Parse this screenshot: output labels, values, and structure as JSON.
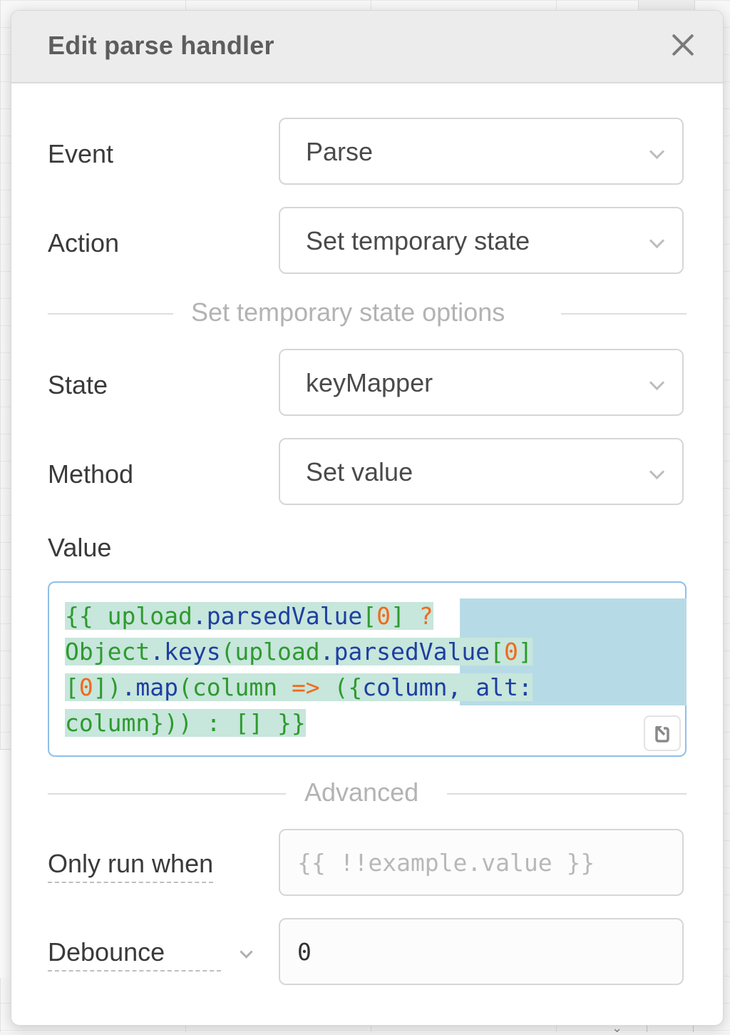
{
  "modal": {
    "title": "Edit parse handler",
    "close_icon": "close-icon"
  },
  "fields": {
    "event": {
      "label": "Event",
      "value": "Parse"
    },
    "action": {
      "label": "Action",
      "value": "Set temporary state"
    },
    "section_options": "Set temporary state options",
    "state": {
      "label": "State",
      "value": "keyMapper"
    },
    "method": {
      "label": "Method",
      "value": "Set value"
    },
    "value": {
      "label": "Value",
      "code_lines": [
        [
          {
            "t": "{{ ",
            "c": "g"
          },
          {
            "t": "upload",
            "c": "g"
          },
          {
            "t": ".parsedValue",
            "c": "b"
          },
          {
            "t": "[",
            "c": "g"
          },
          {
            "t": "0",
            "c": "o"
          },
          {
            "t": "] ",
            "c": "g"
          },
          {
            "t": "?",
            "c": "o"
          }
        ],
        [
          {
            "t": "Object",
            "c": "g"
          },
          {
            "t": ".keys",
            "c": "b"
          },
          {
            "t": "(upload",
            "c": "g"
          },
          {
            "t": ".parsedValue",
            "c": "b"
          },
          {
            "t": "[",
            "c": "g"
          },
          {
            "t": "0",
            "c": "o"
          },
          {
            "t": "]",
            "c": "g"
          }
        ],
        [
          {
            "t": "[",
            "c": "g"
          },
          {
            "t": "0",
            "c": "o"
          },
          {
            "t": "])",
            "c": "g"
          },
          {
            "t": ".map",
            "c": "b"
          },
          {
            "t": "(column ",
            "c": "g"
          },
          {
            "t": "=>",
            "c": "o"
          },
          {
            "t": " ({",
            "c": "g"
          },
          {
            "t": "column, alt:",
            "c": "b"
          }
        ],
        [
          {
            "t": "column}))",
            "c": "g"
          },
          {
            "t": " : ",
            "c": "g"
          },
          {
            "t": "[] }}",
            "c": "g"
          }
        ]
      ],
      "expand_icon": "expand-icon"
    },
    "section_advanced": "Advanced",
    "only_run_when": {
      "label": "Only run when",
      "placeholder": "{{ !!example.value }}"
    },
    "debounce": {
      "label": "Debounce",
      "value": "0"
    }
  },
  "colors": {
    "code_green": "#2e9a2e",
    "code_blue": "#1e3fa0",
    "code_orange": "#f06a1c",
    "focus_border": "#8fbfe8"
  }
}
